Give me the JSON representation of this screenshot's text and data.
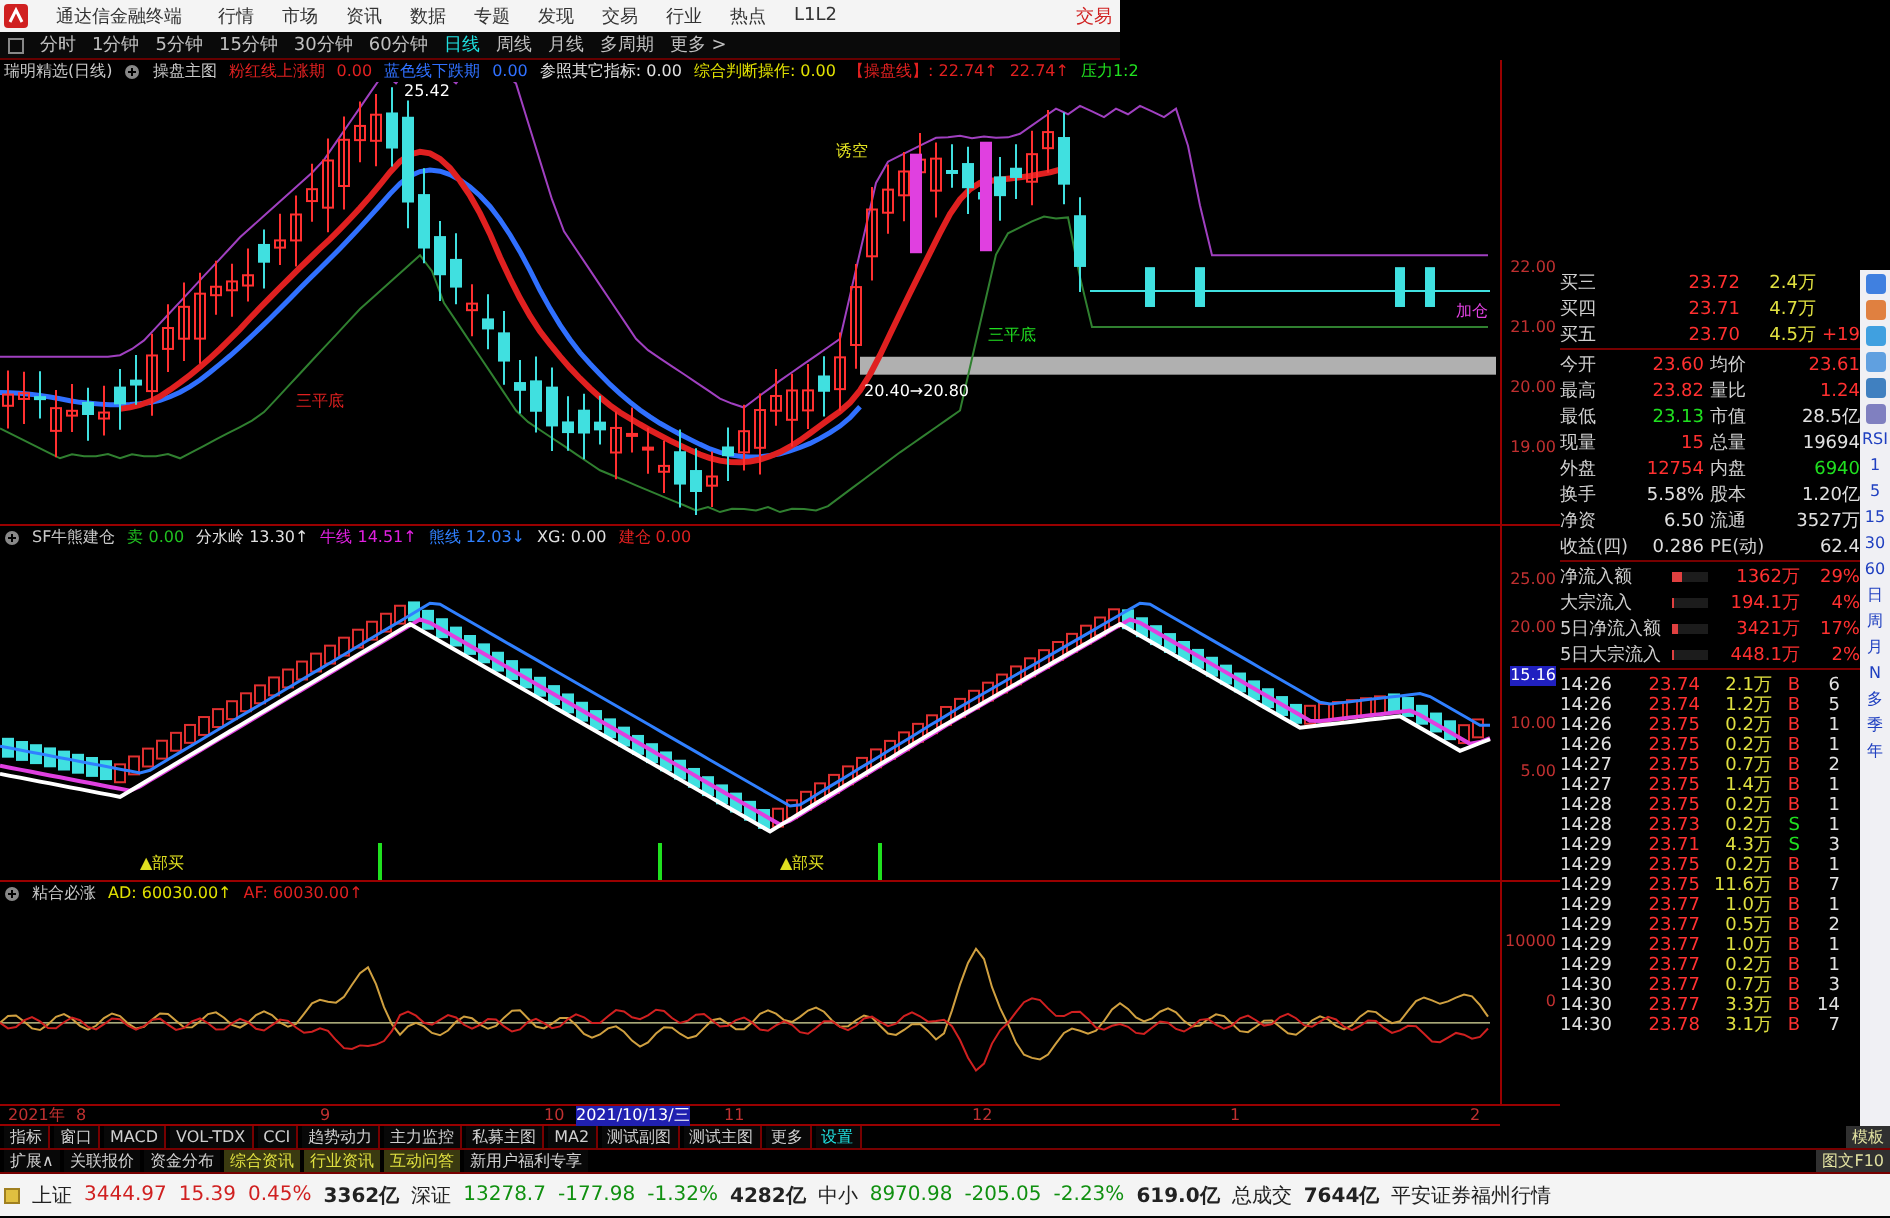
{
  "title_bar": {
    "app_name": "通达信金融终端",
    "menus": [
      "行情",
      "市场",
      "资讯",
      "数据",
      "专题",
      "发现",
      "交易",
      "行业",
      "热点",
      "L1L2"
    ],
    "trade_button": "交易"
  },
  "period_bar": {
    "items": [
      {
        "label": "分时",
        "selected": false
      },
      {
        "label": "1分钟",
        "selected": false
      },
      {
        "label": "5分钟",
        "selected": false
      },
      {
        "label": "15分钟",
        "selected": false
      },
      {
        "label": "30分钟",
        "selected": false
      },
      {
        "label": "60分钟",
        "selected": false
      },
      {
        "label": "日线",
        "selected": true
      },
      {
        "label": "周线",
        "selected": false
      },
      {
        "label": "月线",
        "selected": false
      },
      {
        "label": "多周期",
        "selected": false
      },
      {
        "label": "更多 >",
        "selected": false
      }
    ]
  },
  "price_panel": {
    "header": [
      {
        "text": "瑞明精选(日线)",
        "color": "#c8c8c8"
      },
      {
        "text": "操盘主图",
        "color": "#c8c8c8"
      },
      {
        "text": "粉红线上涨期",
        "color": "#e02020"
      },
      {
        "text": "0.00",
        "color": "#e02020"
      },
      {
        "text": "蓝色线下跌期",
        "color": "#3070ff"
      },
      {
        "text": "0.00",
        "color": "#3070ff"
      },
      {
        "text": "参照其它指标: 0.00",
        "color": "#e0e0e0"
      },
      {
        "text": "综合判断操作: 0.00",
        "color": "#e0e000"
      },
      {
        "text": "【操盘线】: 22.74↑",
        "color": "#e02020"
      },
      {
        "text": "22.74↑",
        "color": "#e02020"
      },
      {
        "text": "压力1:2",
        "color": "#20e020"
      }
    ],
    "annotations": [
      "25.42",
      "三平底",
      "20.40→20.80",
      "三平底",
      "诱空",
      "加仓"
    ],
    "axis": [
      "22.00",
      "21.00",
      "20.00",
      "19.00"
    ]
  },
  "oscillator_panel": {
    "header": [
      {
        "text": "SF牛熊建仓",
        "color": "#c8c8c8"
      },
      {
        "text": "卖 0.00",
        "color": "#20c020"
      },
      {
        "text": "分水岭 13.30↑",
        "color": "#e0e0e0"
      },
      {
        "text": "牛线 14.51↑",
        "color": "#e020e0"
      },
      {
        "text": "熊线 12.03↓",
        "color": "#3080ff"
      },
      {
        "text": "XG: 0.00",
        "color": "#e0e0e0"
      },
      {
        "text": "建仓 0.00",
        "color": "#e02020"
      }
    ],
    "annotations": [
      "▲部买",
      "▲部买"
    ],
    "axis": [
      {
        "text": "25.00",
        "selected": false
      },
      {
        "text": "20.00",
        "selected": false
      },
      {
        "text": "15.16",
        "selected": true
      },
      {
        "text": "10.00",
        "selected": false
      },
      {
        "text": "5.00",
        "selected": false
      }
    ]
  },
  "adhesion_panel": {
    "header": [
      {
        "text": "粘合必涨",
        "color": "#c8c8c8"
      },
      {
        "text": "AD: 60030.00↑",
        "color": "#e0e000"
      },
      {
        "text": "AF: 60030.00↑",
        "color": "#e02020"
      }
    ],
    "axis": [
      "10000",
      "0"
    ]
  },
  "date_axis": [
    {
      "text": "2021年",
      "selected": false
    },
    {
      "text": "8",
      "selected": false
    },
    {
      "text": "9",
      "selected": false
    },
    {
      "text": "10",
      "selected": false
    },
    {
      "text": "2021/10/13/三",
      "selected": true
    },
    {
      "text": "11",
      "selected": false
    },
    {
      "text": "12",
      "selected": false
    },
    {
      "text": "1",
      "selected": false
    },
    {
      "text": "2",
      "selected": false
    }
  ],
  "indicator_tabs": {
    "items": [
      {
        "label": "指标",
        "selected": false
      },
      {
        "label": "窗口",
        "selected": false
      },
      {
        "label": "MACD",
        "selected": false
      },
      {
        "label": "VOL-TDX",
        "selected": false
      },
      {
        "label": "CCI",
        "selected": false
      },
      {
        "label": "趋势动力",
        "selected": false
      },
      {
        "label": "主力监控",
        "selected": false
      },
      {
        "label": "私募主图",
        "selected": false
      },
      {
        "label": "MA2",
        "selected": false
      },
      {
        "label": "测试副图",
        "selected": false
      },
      {
        "label": "测试主图",
        "selected": false
      },
      {
        "label": "更多",
        "selected": false
      },
      {
        "label": "设置",
        "selected": true
      }
    ],
    "right": "模板"
  },
  "info_tabs": {
    "items": [
      {
        "label": "扩展∧",
        "kind": "plain"
      },
      {
        "label": "关联报价",
        "kind": "plain"
      },
      {
        "label": "资金分布",
        "kind": "plain"
      },
      {
        "label": "综合资讯",
        "kind": "highlight"
      },
      {
        "label": "行业资讯",
        "kind": "highlight"
      },
      {
        "label": "互动问答",
        "kind": "highlight"
      },
      {
        "label": "新用户福利专享",
        "kind": "plain"
      }
    ],
    "right": "图文F10"
  },
  "quote": {
    "bids": [
      {
        "label": "买三",
        "price": "23.72",
        "volume": "2.4万"
      },
      {
        "label": "买四",
        "price": "23.71",
        "volume": "4.7万"
      },
      {
        "label": "买五",
        "price": "23.70",
        "volume": "4.5万",
        "extra": "+19"
      }
    ],
    "stats": [
      {
        "label": "今开",
        "value": "23.60",
        "color": "#ff3030"
      },
      {
        "label": "均价",
        "value": "23.61",
        "color": "#ff3030"
      },
      {
        "label": "最高",
        "value": "23.82",
        "color": "#ff3030"
      },
      {
        "label": "量比",
        "value": "1.24",
        "color": "#ff3030"
      },
      {
        "label": "最低",
        "value": "23.13",
        "color": "#20e020"
      },
      {
        "label": "市值",
        "value": "28.5亿",
        "color": "#e0e0e0"
      },
      {
        "label": "现量",
        "value": "15",
        "color": "#ff3030"
      },
      {
        "label": "总量",
        "value": "19694",
        "color": "#e0e0e0"
      },
      {
        "label": "外盘",
        "value": "12754",
        "color": "#ff3030"
      },
      {
        "label": "内盘",
        "value": "6940",
        "color": "#20e020"
      },
      {
        "label": "换手",
        "value": "5.58%",
        "color": "#e0e0e0"
      },
      {
        "label": "股本",
        "value": "1.20亿",
        "color": "#e0e0e0"
      },
      {
        "label": "净资",
        "value": "6.50",
        "color": "#e0e0e0"
      },
      {
        "label": "流通",
        "value": "3527万",
        "color": "#e0e0e0"
      },
      {
        "label": "收益(四)",
        "value": "0.286",
        "color": "#e0e0e0"
      },
      {
        "label": "PE(动)",
        "value": "62.4",
        "color": "#e0e0e0"
      }
    ],
    "fund_flow": [
      {
        "label": "净流入额",
        "value": "1362万",
        "percent": "29%",
        "level": 0.29
      },
      {
        "label": "大宗流入",
        "value": "194.1万",
        "percent": "4%",
        "level": 0.04
      },
      {
        "label": "5日净流入额",
        "value": "3421万",
        "percent": "17%",
        "level": 0.17
      },
      {
        "label": "5日大宗流入",
        "value": "448.1万",
        "percent": "2%",
        "level": 0.02
      }
    ],
    "trades": [
      {
        "time": "14:26",
        "price": "23.74",
        "volume": "2.1万",
        "side": "B",
        "count": "6"
      },
      {
        "time": "14:26",
        "price": "23.74",
        "volume": "1.2万",
        "side": "B",
        "count": "5"
      },
      {
        "time": "14:26",
        "price": "23.75",
        "volume": "0.2万",
        "side": "B",
        "count": "1"
      },
      {
        "time": "14:26",
        "price": "23.75",
        "volume": "0.2万",
        "side": "B",
        "count": "1"
      },
      {
        "time": "14:27",
        "price": "23.75",
        "volume": "0.7万",
        "side": "B",
        "count": "2"
      },
      {
        "time": "14:27",
        "price": "23.75",
        "volume": "1.4万",
        "side": "B",
        "count": "1"
      },
      {
        "time": "14:28",
        "price": "23.75",
        "volume": "0.2万",
        "side": "B",
        "count": "1"
      },
      {
        "time": "14:28",
        "price": "23.73",
        "volume": "0.2万",
        "side": "S",
        "count": "1"
      },
      {
        "time": "14:29",
        "price": "23.71",
        "volume": "4.3万",
        "side": "S",
        "count": "3"
      },
      {
        "time": "14:29",
        "price": "23.75",
        "volume": "0.2万",
        "side": "B",
        "count": "1"
      },
      {
        "time": "14:29",
        "price": "23.75",
        "volume": "11.6万",
        "side": "B",
        "count": "7"
      },
      {
        "time": "14:29",
        "price": "23.77",
        "volume": "1.0万",
        "side": "B",
        "count": "1"
      },
      {
        "time": "14:29",
        "price": "23.77",
        "volume": "0.5万",
        "side": "B",
        "count": "2"
      },
      {
        "time": "14:29",
        "price": "23.77",
        "volume": "1.0万",
        "side": "B",
        "count": "1"
      },
      {
        "time": "14:29",
        "price": "23.77",
        "volume": "0.2万",
        "side": "B",
        "count": "1"
      },
      {
        "time": "14:30",
        "price": "23.77",
        "volume": "0.7万",
        "side": "B",
        "count": "3"
      },
      {
        "time": "14:30",
        "price": "23.77",
        "volume": "3.3万",
        "side": "B",
        "count": "14"
      },
      {
        "time": "14:30",
        "price": "23.78",
        "volume": "3.1万",
        "side": "B",
        "count": "7"
      }
    ]
  },
  "side_toolbar": [
    "RSI",
    "1",
    "5",
    "15",
    "30",
    "60",
    "日",
    "周",
    "月",
    "N",
    "多",
    "季",
    "年"
  ],
  "status_bar": {
    "indices": [
      {
        "name": "上证",
        "value": "3444.97",
        "change": "15.39",
        "percent": "0.45%",
        "amount": "3362亿",
        "color": "#d02020"
      },
      {
        "name": "深证",
        "value": "13278.7",
        "change": "-177.98",
        "percent": "-1.32%",
        "amount": "4282亿",
        "color": "#109010"
      },
      {
        "name": "中小",
        "value": "8970.98",
        "change": "-205.05",
        "percent": "-2.23%",
        "amount": "619.0亿",
        "color": "#109010"
      }
    ],
    "total_label": "总成交",
    "total": "7644亿",
    "broker": "平安证券福州行情"
  }
}
